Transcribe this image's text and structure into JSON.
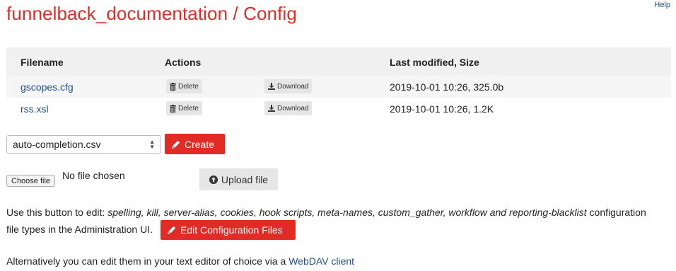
{
  "page": {
    "title": "funnelback_documentation / Config",
    "help_link": "Help"
  },
  "table": {
    "headers": [
      "Filename",
      "Actions",
      "Last modified, Size"
    ],
    "rows": [
      {
        "filename": "gscopes.cfg",
        "delete_label": "Delete",
        "download_label": "Download",
        "modified": "2019-10-01 10:26, 325.0b"
      },
      {
        "filename": "rss.xsl",
        "delete_label": "Delete",
        "download_label": "Download",
        "modified": "2019-10-01 10:26, 1.2K"
      }
    ]
  },
  "create": {
    "selected_option": "auto-completion.csv",
    "button_label": "Create"
  },
  "upload": {
    "choose_label": "Choose file",
    "status": "No file chosen",
    "button_label": "Upload file"
  },
  "edit_section": {
    "intro": "Use this button to edit: ",
    "types": "spelling, kill, server-alias, cookies, hook scripts, meta-names, custom_gather, workflow and reporting-blacklist",
    "after_types": " configuration",
    "line2": "file types in the Administration UI.",
    "button_label": "Edit Configuration Files"
  },
  "footer": {
    "text": "Alternatively you can edit them in your text editor of choice via a ",
    "link": "WebDAV client"
  },
  "colors": {
    "accent_red": "#e32b26",
    "link_blue": "#1d4f91"
  }
}
